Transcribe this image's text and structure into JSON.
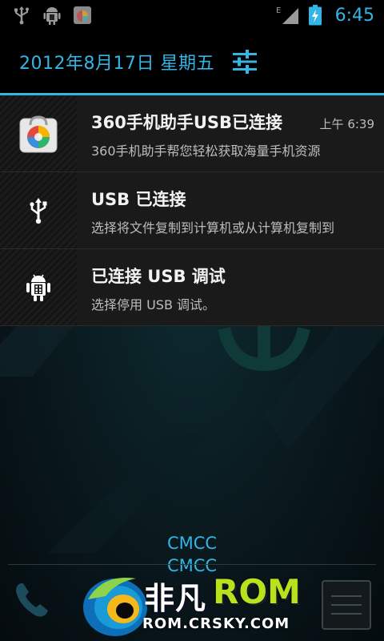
{
  "status_bar": {
    "left_icons": [
      "usb-icon",
      "android-debug-icon",
      "360-app-icon"
    ],
    "right_icons": [
      "signal-e-icon",
      "battery-charging-icon"
    ],
    "network_type": "E",
    "time": "6:45"
  },
  "header": {
    "date": "2012年8月17日 星期五",
    "settings_icon": "quick-settings-icon"
  },
  "notifications": [
    {
      "icon": "360-assistant-icon",
      "title": "360手机助手USB已连接",
      "time": "上午 6:39",
      "text": "360手机助手帮您轻松获取海量手机资源"
    },
    {
      "icon": "usb-icon",
      "title": "USB 已连接",
      "time": "",
      "text": "选择将文件复制到计算机或从计算机复制到"
    },
    {
      "icon": "android-debug-icon",
      "title": "已连接 USB 调试",
      "time": "",
      "text": "选择停用 USB 调试。"
    }
  ],
  "carriers": [
    "CMCC",
    "CMCC"
  ],
  "watermark": {
    "brand_cn": "非凡",
    "brand_rom": "ROM",
    "url": "ROM.CRSKY.COM"
  },
  "colors": {
    "accent": "#33b5e5",
    "watermark_green": "#b7e21d"
  }
}
